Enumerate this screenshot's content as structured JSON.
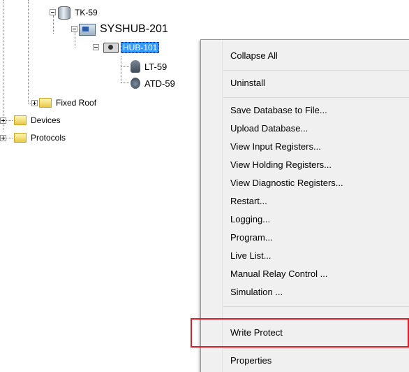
{
  "tree": {
    "nodes": {
      "tk59": "TK-59",
      "syshub": "SYSHUB-201",
      "hub": "HUB-101",
      "lt": "LT-59",
      "atd": "ATD-59",
      "fixed_roof": "Fixed Roof",
      "devices": "Devices",
      "protocols": "Protocols"
    }
  },
  "context_menu": {
    "items": [
      {
        "label": "Collapse All"
      },
      {
        "label": "Uninstall"
      },
      {
        "label": "Save Database to File..."
      },
      {
        "label": "Upload Database..."
      },
      {
        "label": "View Input Registers..."
      },
      {
        "label": "View Holding Registers..."
      },
      {
        "label": "View Diagnostic Registers..."
      },
      {
        "label": "Restart..."
      },
      {
        "label": "Logging..."
      },
      {
        "label": "Program..."
      },
      {
        "label": "Live List..."
      },
      {
        "label": "Manual Relay Control ..."
      },
      {
        "label": "Simulation ..."
      },
      {
        "label": "Write Protect"
      },
      {
        "label": "Properties"
      }
    ]
  },
  "colors": {
    "selection": "#3399ff",
    "highlight_box": "#d81f26",
    "menu_background": "#f0f0f0"
  }
}
